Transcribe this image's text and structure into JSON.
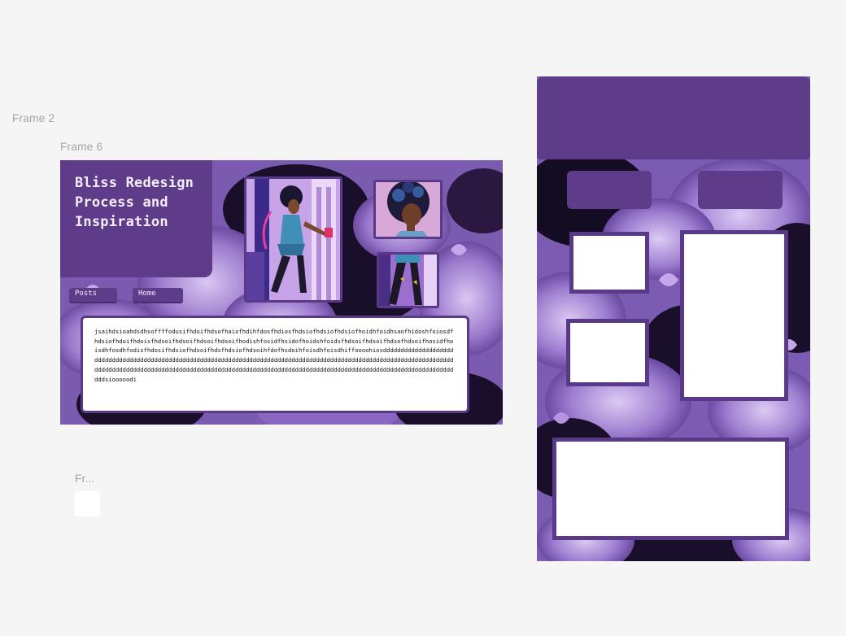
{
  "canvas": {
    "frame_labels": {
      "frame2": "Frame 2",
      "frame6": "Frame 6",
      "frame_small": "Fr..."
    }
  },
  "frame6": {
    "title": "Bliss Redesign\nProcess and\nInspiration",
    "nav": {
      "posts": "Posts",
      "home": "Home"
    },
    "body_text": "jsaihdsioahdsdhsoffffodusifhdoifhdsofhaiofhdihfdosfhdiosfhdsiofhdsiofhdsiofhoidhfoidhsaofhidoshfoiosdfhdsiofhdoifhdoisfhdsoifhdsoifhdsoifhdsoifhodishfosidfhsidofhoidshfoidsfhdsoifhdsoifhdsofhdsoifhosidfhoisdhfosdhfodisfhdosifhdsiofhdsoifhdsfhdsiofhdsoihfdofhsdoihfoisdhfoisdhiffoooohiosdddddddddddddddddddddddddddddddddddddddddddddddddddddddddddddddddddddddddddddddddddddddddddddddddddddddddddddddddddddddddddddddddddddddddddddddddddddddddddddddddddddddddddddddddddddddddddddddddddddddddddddddddddddddddddddddddddsiooooodi"
  },
  "colors": {
    "canvas_bg": "#f5f5f5",
    "accent_purple": "#5e3c8a",
    "border_purple": "#5a3a88",
    "label_gray": "#a6a6a6",
    "bg_lavender": "#a98ad6",
    "bg_dark": "#0e0818"
  },
  "icons": {
    "photo_full_character": "character-illustration",
    "photo_portrait": "character-portrait",
    "photo_legs": "character-legs-detail"
  }
}
